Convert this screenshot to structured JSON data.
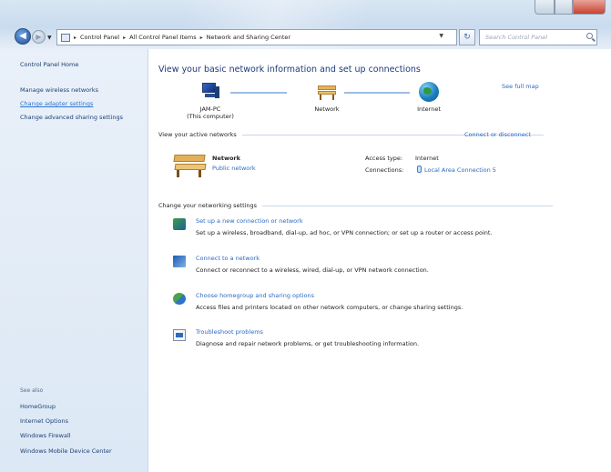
{
  "nav": {
    "address_crumbs": [
      "Control Panel",
      "All Control Panel Items",
      "Network and Sharing Center"
    ],
    "search_placeholder": "Search Control Panel"
  },
  "sidebar": {
    "home": "Control Panel Home",
    "links": [
      "Manage wireless networks",
      "Change adapter settings",
      "Change advanced sharing settings"
    ],
    "see_also_title": "See also",
    "see_also": [
      "HomeGroup",
      "Internet Options",
      "Windows Firewall",
      "Windows Mobile Device Center"
    ]
  },
  "main": {
    "title": "View your basic network information and set up connections",
    "see_full_map": "See full map",
    "map": {
      "pc_name": "JAM-PC",
      "pc_subtitle": "(This computer)",
      "network": "Network",
      "internet": "Internet"
    },
    "active_header": "View your active networks",
    "connect_disconnect": "Connect or disconnect",
    "active_network": {
      "name": "Network",
      "type": "Public network",
      "access_type_label": "Access type:",
      "access_type_value": "Internet",
      "connections_label": "Connections:",
      "connections_value": "Local Area Connection 5"
    },
    "change_header": "Change your networking settings",
    "tasks": [
      {
        "title": "Set up a new connection or network",
        "desc": "Set up a wireless, broadband, dial-up, ad hoc, or VPN connection; or set up a router or access point."
      },
      {
        "title": "Connect to a network",
        "desc": "Connect or reconnect to a wireless, wired, dial-up, or VPN network connection."
      },
      {
        "title": "Choose homegroup and sharing options",
        "desc": "Access files and printers located on other network computers, or change sharing settings."
      },
      {
        "title": "Troubleshoot problems",
        "desc": "Diagnose and repair network problems, or get troubleshooting information."
      }
    ]
  }
}
